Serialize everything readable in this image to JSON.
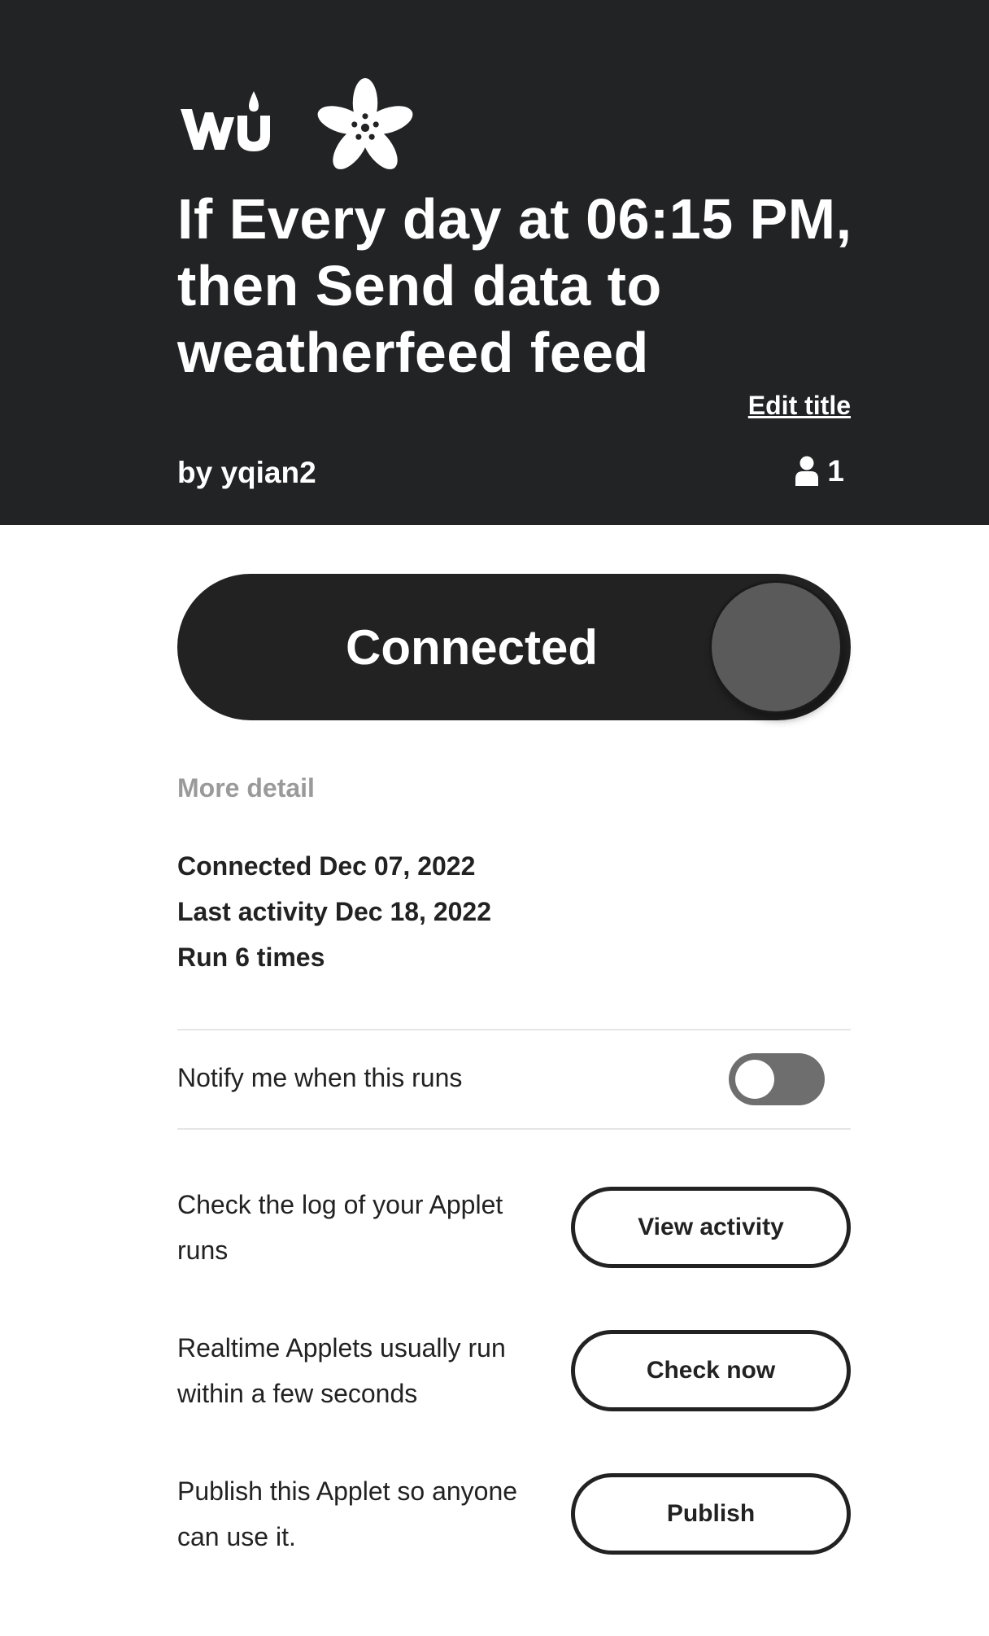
{
  "header": {
    "icons": [
      "weather-underground-logo",
      "adafruit-flower-logo"
    ],
    "wu_logo_text": "wu",
    "title": "If Every day at 06:15 PM, then Send data to weatherfeed feed",
    "edit_title_label": "Edit title",
    "author": "by yqian2",
    "user_count": "1",
    "background_color": "#222325"
  },
  "connection": {
    "label": "Connected",
    "state": "on"
  },
  "details": {
    "more_detail_label": "More detail",
    "connected": "Connected Dec 07, 2022",
    "last_activity": "Last activity Dec 18, 2022",
    "runs": "Run 6 times"
  },
  "notify": {
    "label": "Notify me when this runs",
    "enabled": false
  },
  "actions": [
    {
      "text": "Check the log of your Applet runs",
      "button": "View activity"
    },
    {
      "text": "Realtime Applets usually run within a few seconds",
      "button": "Check now"
    },
    {
      "text": "Publish this Applet so anyone can use it.",
      "button": "Publish"
    }
  ]
}
